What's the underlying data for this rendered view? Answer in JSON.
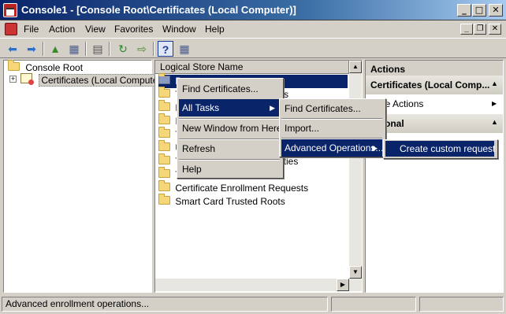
{
  "window": {
    "title": "Console1 - [Console Root\\Certificates (Local Computer)]",
    "min_glyph": "_",
    "max_glyph": "□",
    "close_glyph": "✕"
  },
  "menubar": {
    "items": [
      "File",
      "Action",
      "View",
      "Favorites",
      "Window",
      "Help"
    ],
    "mdi_min": "_",
    "mdi_restore": "❐",
    "mdi_close": "✕"
  },
  "toolbar": {
    "buttons": [
      {
        "icon": "back-arrow-icon",
        "glyph": "⬅",
        "color": "#2a6fc9"
      },
      {
        "icon": "forward-arrow-icon",
        "glyph": "➡",
        "color": "#2a6fc9"
      },
      {
        "icon": "up-folder-icon",
        "glyph": "▲",
        "color": "#3a8a2a"
      },
      {
        "icon": "show-hide-tree-icon",
        "glyph": "▦",
        "color": "#4a5a8a"
      },
      {
        "icon": "properties-icon",
        "glyph": "▤",
        "color": "#555555"
      },
      {
        "icon": "refresh-icon",
        "glyph": "↻",
        "color": "#2a8a2a"
      },
      {
        "icon": "export-list-icon",
        "glyph": "⇨",
        "color": "#4a8a2a"
      },
      {
        "icon": "help-icon",
        "glyph": "?",
        "color": "#1a3a9a"
      },
      {
        "icon": "show-hide-action-pane-icon",
        "glyph": "▦",
        "color": "#4a5a8a"
      }
    ]
  },
  "tree": {
    "root": "Console Root",
    "expander": "+",
    "child": "Certificates (Local Computer)"
  },
  "list": {
    "header": "Logical Store Name",
    "items": [
      {
        "label": "P"
      },
      {
        "label": "T",
        "suffix": "s"
      },
      {
        "label": "E"
      },
      {
        "label": "I"
      },
      {
        "label": "T"
      },
      {
        "label": "U"
      },
      {
        "label": "T",
        "suffix": "rities"
      },
      {
        "label": "T"
      },
      {
        "label": "Certificate Enrollment Requests"
      },
      {
        "label": "Smart Card Trusted Roots"
      }
    ],
    "scroll_up": "▲",
    "scroll_down": "▼",
    "scroll_right": "▶"
  },
  "actions": {
    "header": "Actions",
    "section1": "Certificates (Local Comp...",
    "more_actions": "ore Actions",
    "section2": "ersonal",
    "collapse_glyph": "▲",
    "more_arrow": "▶"
  },
  "context_menu": {
    "items": [
      "Find Certificates...",
      "All Tasks",
      "New Window from Here",
      "Refresh",
      "Help"
    ],
    "arrow": "▶"
  },
  "all_tasks_menu": {
    "items": [
      "Find Certificates...",
      "Import...",
      "Advanced Operations..."
    ],
    "arrow": "▶"
  },
  "advanced_menu": {
    "items": [
      "Create custom request"
    ]
  },
  "statusbar": {
    "text": "Advanced enrollment operations..."
  },
  "colors": {
    "title_bar": "#0a246a",
    "selection": "#0a246a",
    "face": "#d4d0c8"
  }
}
